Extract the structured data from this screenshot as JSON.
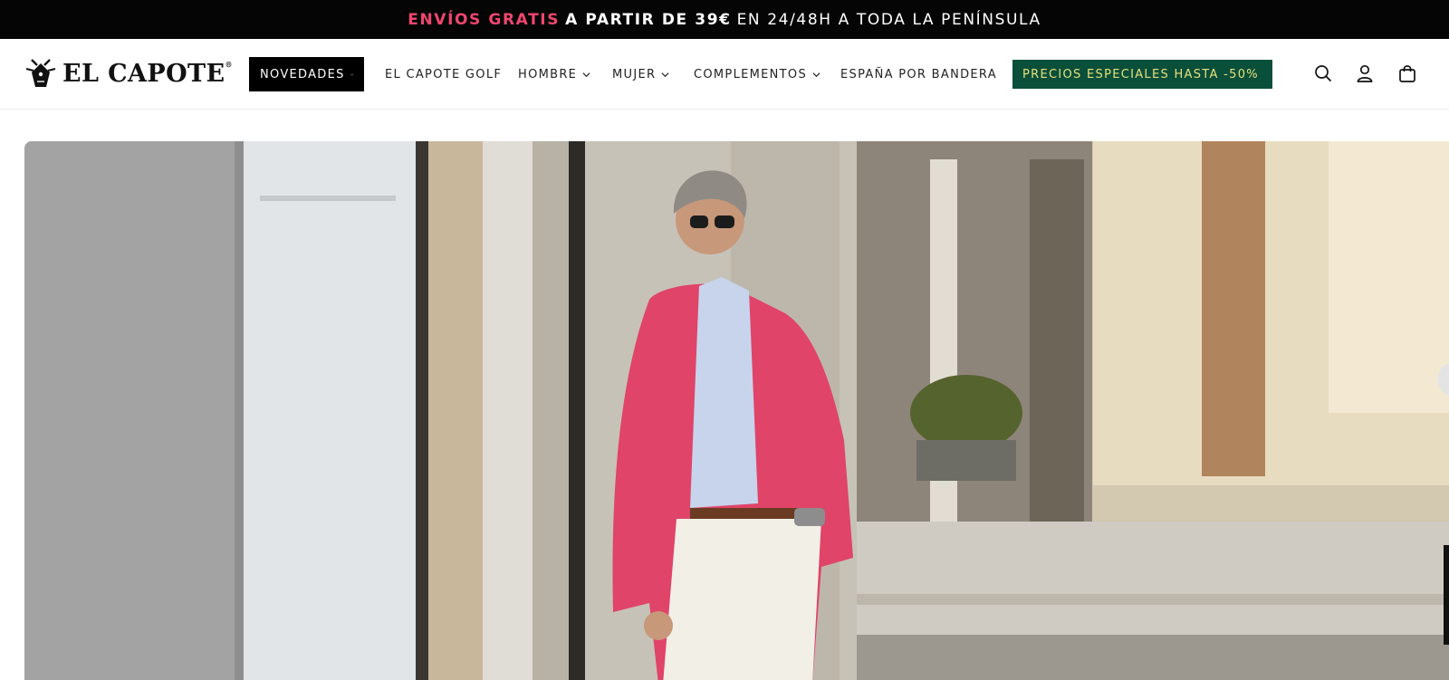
{
  "announcement": {
    "highlight": "ENVÍOS GRATIS",
    "bold": "A PARTIR DE 39€",
    "rest": "EN 24/48H A TODA LA PENÍNSULA"
  },
  "brand": {
    "name": "EL CAPOTE",
    "mark": "®"
  },
  "nav": {
    "items": [
      {
        "label": "NOVEDADES",
        "has_dropdown": true,
        "active": true
      },
      {
        "label": "EL CAPOTE GOLF",
        "has_dropdown": false
      },
      {
        "label": "HOMBRE",
        "has_dropdown": true
      },
      {
        "label": "MUJER",
        "has_dropdown": true
      },
      {
        "label": "COMPLEMENTOS",
        "has_dropdown": true
      },
      {
        "label": "ESPAÑA POR BANDERA",
        "has_dropdown": false
      },
      {
        "label": "PRECIOS ESPECIALES HASTA -50%",
        "has_dropdown": true,
        "promo": true
      }
    ]
  },
  "header_icons": [
    "search-icon",
    "account-icon",
    "cart-icon"
  ],
  "colors": {
    "announcement_bg": "#050505",
    "announcement_highlight": "#f0466e",
    "promo_bg": "#0a4f3a",
    "promo_text": "#e6e07a",
    "active_nav_bg": "#000000"
  },
  "hero": {
    "image_description_icon": "hero-banner-image"
  }
}
